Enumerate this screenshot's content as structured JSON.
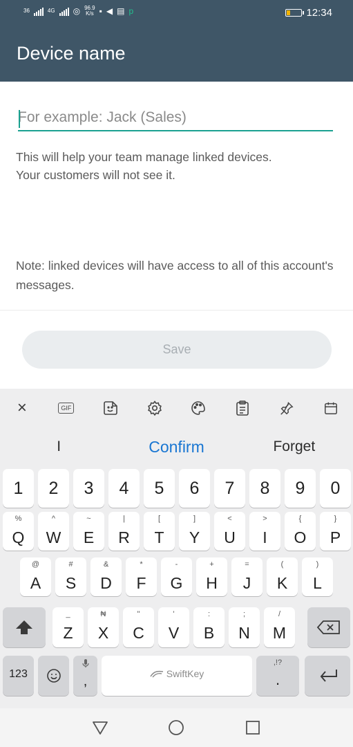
{
  "status_bar": {
    "network_1": "36",
    "network_2": "4G",
    "speed_value": "96.9",
    "speed_unit": "K/s",
    "time": "12:34",
    "battery_level": 0.2
  },
  "app_bar": {
    "title": "Device name"
  },
  "form": {
    "input_placeholder": "For example: Jack (Sales)",
    "input_value": "",
    "help_line1": "This will help your team manage linked devices.",
    "help_line2": "Your customers will not see it.",
    "note": "Note: linked devices will have access to all of this account's messages.",
    "save_label": "Save"
  },
  "keyboard": {
    "toolbar": {
      "close": "×",
      "gif": "GIF"
    },
    "suggestions": [
      "I",
      "Confirm",
      "Forget"
    ],
    "numbers": [
      "1",
      "2",
      "3",
      "4",
      "5",
      "6",
      "7",
      "8",
      "9",
      "0"
    ],
    "row1": [
      {
        "k": "Q",
        "s": "%"
      },
      {
        "k": "W",
        "s": "^"
      },
      {
        "k": "E",
        "s": "~"
      },
      {
        "k": "R",
        "s": "|"
      },
      {
        "k": "T",
        "s": "["
      },
      {
        "k": "Y",
        "s": "]"
      },
      {
        "k": "U",
        "s": "<"
      },
      {
        "k": "I",
        "s": ">"
      },
      {
        "k": "O",
        "s": "{"
      },
      {
        "k": "P",
        "s": "}"
      }
    ],
    "row2": [
      {
        "k": "A",
        "s": "@"
      },
      {
        "k": "S",
        "s": "#"
      },
      {
        "k": "D",
        "s": "&"
      },
      {
        "k": "F",
        "s": "*"
      },
      {
        "k": "G",
        "s": "-"
      },
      {
        "k": "H",
        "s": "+"
      },
      {
        "k": "J",
        "s": "="
      },
      {
        "k": "K",
        "s": "("
      },
      {
        "k": "L",
        "s": ")"
      }
    ],
    "row3": [
      {
        "k": "Z",
        "s": "_"
      },
      {
        "k": "X",
        "s": "₦"
      },
      {
        "k": "C",
        "s": "\""
      },
      {
        "k": "V",
        "s": "'"
      },
      {
        "k": "B",
        "s": ":"
      },
      {
        "k": "N",
        "s": ";"
      },
      {
        "k": "M",
        "s": "/"
      }
    ],
    "bottom": {
      "numbers_label": "123",
      "comma": ",",
      "space_label": "SwiftKey",
      "period": ".",
      "punct_hint": ",!?"
    }
  }
}
